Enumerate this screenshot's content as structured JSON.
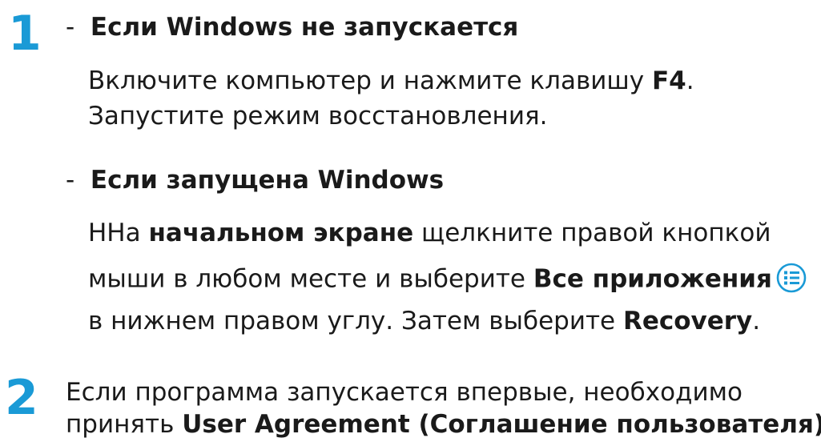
{
  "step1": {
    "number": "1",
    "case1": {
      "dash": "-",
      "heading": "Если Windows не запускается",
      "line1_pre": "Включите компьютер и нажмите клавишу ",
      "line1_key": "F4",
      "line1_post": ".",
      "line2": "Запустите режим восстановления."
    },
    "case2": {
      "dash": "-",
      "heading": "Если запущена Windows",
      "line1_pre": "ННа ",
      "line1_bold": "начальном экране",
      "line1_post": " щелкните правой кнопкой",
      "line2_pre": "мыши в любом месте и выберите ",
      "line2_bold": "Все приложения",
      "line3_pre": "в нижнем правом углу. Затем выберите ",
      "line3_bold": "Recovery",
      "line3_post": "."
    }
  },
  "step2": {
    "number": "2",
    "line1": "Если программа запускается впервые, необходимо",
    "line2_pre": "принять ",
    "line2_bold": "User Agreement (Соглашение пользователя)",
    "line2_post": "."
  },
  "icons": {
    "apps": "all-apps-icon"
  },
  "colors": {
    "step_number": "#1a9ad6",
    "icon": "#1a9ad6"
  }
}
